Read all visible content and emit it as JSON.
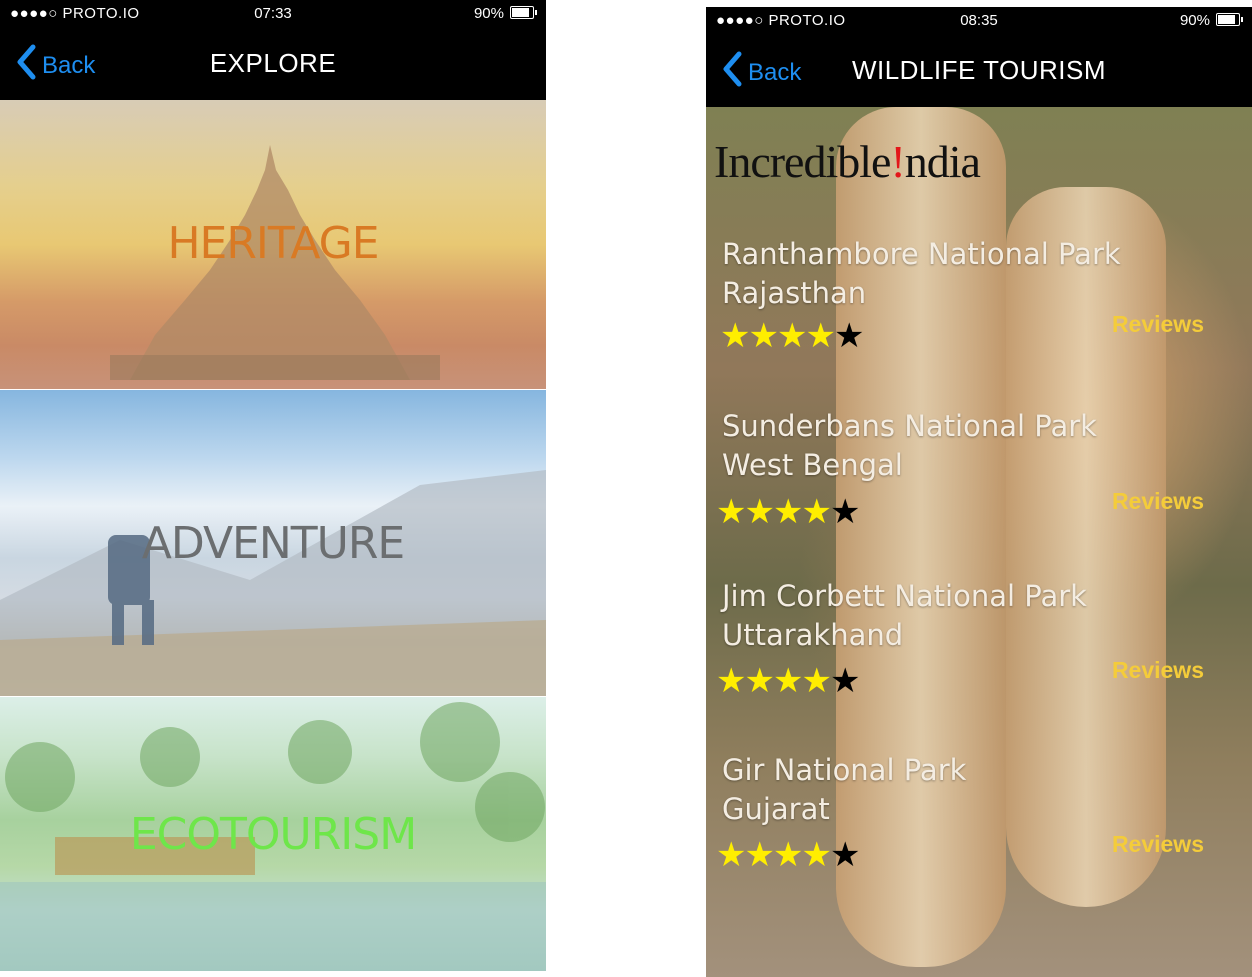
{
  "left_screen": {
    "status": {
      "signal": "●●●●○ PROTO.IO",
      "time": "07:33",
      "battery": "90%"
    },
    "nav": {
      "back_label": "Back",
      "title": "EXPLORE"
    },
    "tiles": [
      {
        "label": "HERITAGE",
        "color": "#d97a24"
      },
      {
        "label": "ADVENTURE",
        "color": "#6b6e70"
      },
      {
        "label": "ECOTOURISM",
        "color": "#6ee64a"
      }
    ]
  },
  "right_screen": {
    "status": {
      "signal": "●●●●○ PROTO.IO",
      "time": "08:35",
      "battery": "90%"
    },
    "nav": {
      "back_label": "Back",
      "title": "WILDLIFE TOURISM"
    },
    "logo": {
      "pre": "Incredible",
      "mark": "!",
      "post": "ndia"
    },
    "parks": [
      {
        "name": "Ranthambore National Park",
        "state": "Rajasthan",
        "rating": 4,
        "max": 5,
        "reviews_label": "Reviews"
      },
      {
        "name": "Sunderbans National Park",
        "state": "West Bengal",
        "rating": 4,
        "max": 5,
        "reviews_label": "Reviews"
      },
      {
        "name": "Jim Corbett National Park",
        "state": "Uttarakhand",
        "rating": 4,
        "max": 5,
        "reviews_label": "Reviews"
      },
      {
        "name": "Gir National Park",
        "state": "Gujarat",
        "rating": 4,
        "max": 5,
        "reviews_label": "Reviews"
      }
    ],
    "star_char": "★",
    "accent_back": "#1e8ef0",
    "accent_reviews": "#f4cc3a"
  }
}
